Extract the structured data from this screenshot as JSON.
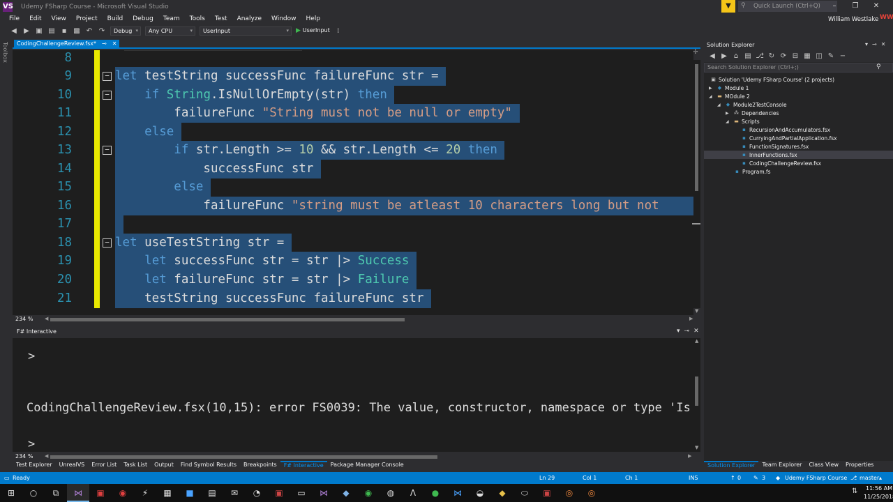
{
  "window": {
    "title": "Udemy FSharp Course - Microsoft Visual Studio",
    "logo": "VS",
    "quick_launch_placeholder": "Quick Launch (Ctrl+Q)",
    "controls": {
      "minimize": "–",
      "maximize": "❐",
      "close": "✕"
    }
  },
  "user": {
    "name": "William Westlake",
    "initials": "WW"
  },
  "menu": [
    "File",
    "Edit",
    "View",
    "Project",
    "Build",
    "Debug",
    "Team",
    "Tools",
    "Test",
    "Analyze",
    "Window",
    "Help"
  ],
  "toolbar": {
    "config": "Debug",
    "platform": "Any CPU",
    "startup_project": "UserInput",
    "run_label": "UserInput"
  },
  "toolbox_label": "Toolbox",
  "document_tab": {
    "label": "CodingChallengeReview.fsx*",
    "pin": "⊸",
    "close": "✕"
  },
  "editor": {
    "zoom": "234 %",
    "lines": [
      {
        "num": "8",
        "text": ""
      },
      {
        "num": "9",
        "text": "let testString successFunc failureFunc str ="
      },
      {
        "num": "10",
        "text": "    if String.IsNullOrEmpty(str) then"
      },
      {
        "num": "11",
        "text": "        failureFunc \"String must not be null or empty\""
      },
      {
        "num": "12",
        "text": "    else"
      },
      {
        "num": "13",
        "text": "        if str.Length >= 10 && str.Length <= 20 then"
      },
      {
        "num": "14",
        "text": "            successFunc str"
      },
      {
        "num": "15",
        "text": "        else"
      },
      {
        "num": "16",
        "text": "            failureFunc \"string must be atleast 10 characters long but not"
      },
      {
        "num": "17",
        "text": ""
      },
      {
        "num": "18",
        "text": "let useTestString str ="
      },
      {
        "num": "19",
        "text": "    let successFunc str = str |> Success"
      },
      {
        "num": "20",
        "text": "    let failureFunc str = str |> Failure"
      },
      {
        "num": "21",
        "text": "    testString successFunc failureFunc str"
      }
    ]
  },
  "fsi": {
    "title": "F# Interactive",
    "prompt": ">",
    "error": "CodingChallengeReview.fsx(10,15): error FS0039: The value, constructor, namespace or type 'Is",
    "zoom": "234 %"
  },
  "bottom_tabs": [
    {
      "label": "Test Explorer",
      "active": false
    },
    {
      "label": "UnrealVS",
      "active": false
    },
    {
      "label": "Error List",
      "active": false
    },
    {
      "label": "Task List",
      "active": false
    },
    {
      "label": "Output",
      "active": false
    },
    {
      "label": "Find Symbol Results",
      "active": false
    },
    {
      "label": "Breakpoints",
      "active": false
    },
    {
      "label": "F# Interactive",
      "active": true
    },
    {
      "label": "Package Manager Console",
      "active": false
    }
  ],
  "solution_explorer": {
    "title": "Solution Explorer",
    "search_placeholder": "Search Solution Explorer (Ctrl+;)",
    "tree": [
      {
        "label": "Solution 'Udemy FSharp Course' (2 projects)",
        "icon": "solution-icon"
      },
      {
        "label": "Module 1",
        "icon": "fsharp-project-icon"
      },
      {
        "label": "MOdule 2",
        "icon": "folder-icon"
      },
      {
        "label": "Module2TestConsole",
        "icon": "fsharp-project-icon"
      },
      {
        "label": "Dependencies",
        "icon": "dependencies-icon"
      },
      {
        "label": "Scripts",
        "icon": "folder-icon"
      },
      {
        "label": "RecursionAndAccumulators.fsx",
        "icon": "fsx-file-icon"
      },
      {
        "label": "CurryingAndPartialApplication.fsx",
        "icon": "fsx-file-icon"
      },
      {
        "label": "FunctionSignatures.fsx",
        "icon": "fsx-file-icon"
      },
      {
        "label": "InnerFunctions.fsx",
        "icon": "fsx-file-icon"
      },
      {
        "label": "CodingChallengeReview.fsx",
        "icon": "fsx-file-icon"
      },
      {
        "label": "Program.fs",
        "icon": "fs-file-icon"
      }
    ],
    "tabs": [
      "Solution Explorer",
      "Team Explorer",
      "Class View",
      "Properties"
    ]
  },
  "status": {
    "ready": "Ready",
    "ln": "Ln 29",
    "col": "Col 1",
    "ch": "Ch 1",
    "ins": "INS",
    "up_count": "0",
    "pencil_count": "3",
    "repo": "Udemy FSharp Course",
    "branch": "master"
  },
  "clock": {
    "time": "11:56 AM",
    "date": "11/25/2018"
  },
  "colors": {
    "accent": "#007acc",
    "selection": "#264f78",
    "keyword": "#569cd6",
    "type": "#4ec9b0",
    "string": "#d69d85",
    "number": "#b5cea8",
    "line_number": "#2b91af"
  }
}
